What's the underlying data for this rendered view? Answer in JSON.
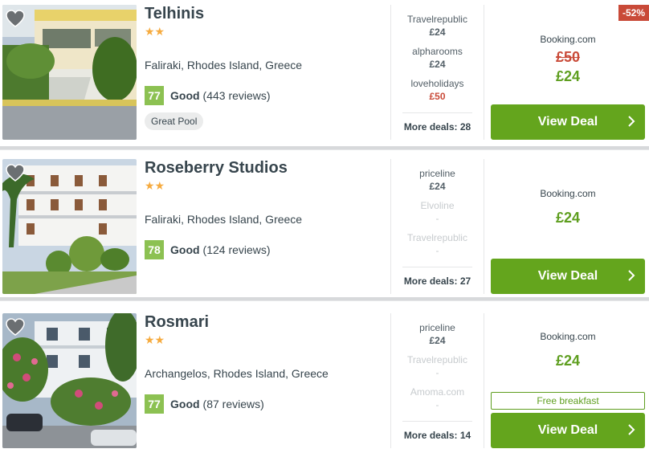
{
  "hotels": [
    {
      "name": "Telhinis",
      "stars": "★★",
      "location": "Faliraki, Rhodes Island, Greece",
      "score": "77",
      "rating_label": "Good",
      "reviews": "(443 reviews)",
      "tag": "Great Pool",
      "deals": [
        {
          "provider": "Travelrepublic",
          "price": "£24"
        },
        {
          "provider": "alpharooms",
          "price": "£24"
        },
        {
          "provider": "loveholidays",
          "price": "£50"
        }
      ],
      "more_deals": "More deals: 28",
      "main_provider": "Booking.com",
      "old_price": "£50",
      "price": "£24",
      "discount": "-52%",
      "cta": "View Deal"
    },
    {
      "name": "Roseberry Studios",
      "stars": "★★",
      "location": "Faliraki, Rhodes Island, Greece",
      "score": "78",
      "rating_label": "Good",
      "reviews": "(124 reviews)",
      "deals": [
        {
          "provider": "priceline",
          "price": "£24"
        },
        {
          "provider": "Elvoline",
          "price": "-"
        },
        {
          "provider": "Travelrepublic",
          "price": "-"
        }
      ],
      "more_deals": "More deals: 27",
      "main_provider": "Booking.com",
      "price": "£24",
      "cta": "View Deal"
    },
    {
      "name": "Rosmari",
      "stars": "★★",
      "location": "Archangelos, Rhodes Island, Greece",
      "score": "77",
      "rating_label": "Good",
      "reviews": "(87 reviews)",
      "deals": [
        {
          "provider": "priceline",
          "price": "£24"
        },
        {
          "provider": "Travelrepublic",
          "price": "-"
        },
        {
          "provider": "Amoma.com",
          "price": "-"
        }
      ],
      "more_deals": "More deals: 14",
      "main_provider": "Booking.com",
      "price": "£24",
      "perk": "Free breakfast",
      "cta": "View Deal"
    }
  ],
  "icons": {
    "favorite": "heart-icon",
    "chevron": "chevron-right-icon",
    "star": "star-icon"
  },
  "colors": {
    "cta": "#64a51d",
    "price": "#5e9e1f",
    "discount": "#c94a38",
    "score": "#8cc152",
    "stars": "#f6ab3f"
  }
}
